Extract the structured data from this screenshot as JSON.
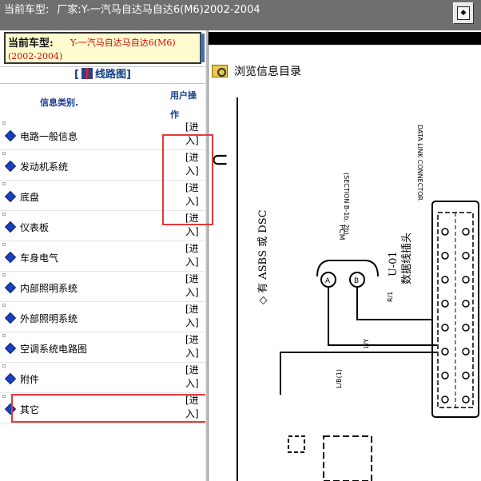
{
  "topbar": {
    "car_label": "当前车型:",
    "maker": "厂家:Y-一汽马自达马自达6(M6)2002-2004"
  },
  "car_box": {
    "label": "当前车型:",
    "model": "Y-一汽马自达马自达6(M6)",
    "years": "(2002-2004)"
  },
  "section": {
    "bracket_open": "[",
    "title": "线路图",
    "bracket_close": "]"
  },
  "table": {
    "col_category": "信息类别.",
    "col_operation": "用户操作"
  },
  "categories": [
    {
      "label": "电路一般信息",
      "action": "[进入]"
    },
    {
      "label": "发动机系统",
      "action": "[进入]"
    },
    {
      "label": "底盘",
      "action": "[进入]"
    },
    {
      "label": "仪表板",
      "action": "[进入]"
    },
    {
      "label": "车身电气",
      "action": "[进入]"
    },
    {
      "label": "内部照明系统",
      "action": "[进入]"
    },
    {
      "label": "外部照明系统",
      "action": "[进入]"
    },
    {
      "label": "空调系统电路图",
      "action": "[进入]"
    },
    {
      "label": "附件",
      "action": "[进入]"
    },
    {
      "label": "其它",
      "action": "[进入]"
    }
  ],
  "right": {
    "browse_label": "浏览信息目录"
  },
  "diagram": {
    "letter_u": "U",
    "abs_text": "◇ 有 ASBS 或 DSC",
    "pcm": "PCM",
    "section": "(SECTION B-1b, 2b)",
    "connector_code": "U-01",
    "connector_name": "数据线插头",
    "conn_top": "DATA LINK CONNECTOR",
    "r_l": "R/1",
    "l_y": "L/Y",
    "l_b": "L/B(1)",
    "pin_a": "A",
    "pin_b": "B"
  },
  "colors": {
    "highlight": "#e53838",
    "link_blue": "#1a3d8f",
    "model_red": "#d40000"
  }
}
